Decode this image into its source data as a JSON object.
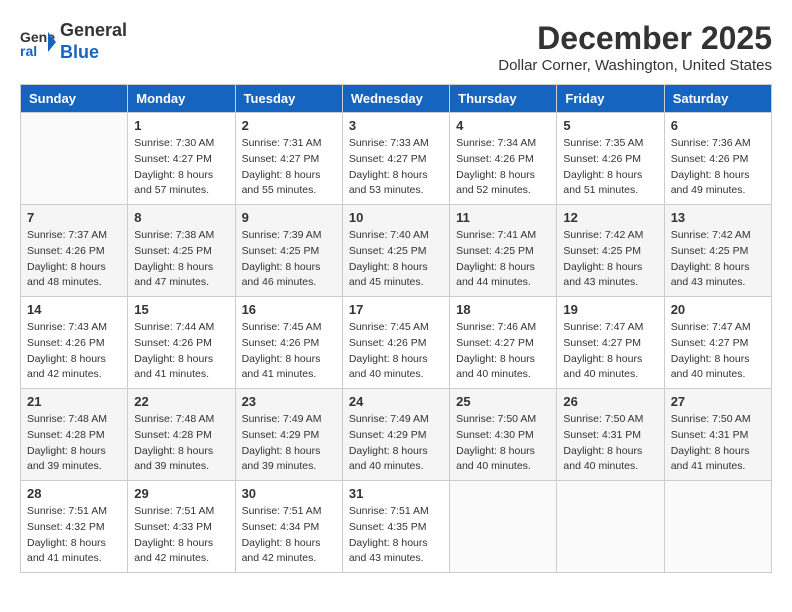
{
  "header": {
    "logo": {
      "line1": "General",
      "line2": "Blue"
    },
    "title": "December 2025",
    "subtitle": "Dollar Corner, Washington, United States"
  },
  "weekdays": [
    "Sunday",
    "Monday",
    "Tuesday",
    "Wednesday",
    "Thursday",
    "Friday",
    "Saturday"
  ],
  "weeks": [
    [
      {
        "day": "",
        "info": ""
      },
      {
        "day": "1",
        "info": "Sunrise: 7:30 AM\nSunset: 4:27 PM\nDaylight: 8 hours\nand 57 minutes."
      },
      {
        "day": "2",
        "info": "Sunrise: 7:31 AM\nSunset: 4:27 PM\nDaylight: 8 hours\nand 55 minutes."
      },
      {
        "day": "3",
        "info": "Sunrise: 7:33 AM\nSunset: 4:27 PM\nDaylight: 8 hours\nand 53 minutes."
      },
      {
        "day": "4",
        "info": "Sunrise: 7:34 AM\nSunset: 4:26 PM\nDaylight: 8 hours\nand 52 minutes."
      },
      {
        "day": "5",
        "info": "Sunrise: 7:35 AM\nSunset: 4:26 PM\nDaylight: 8 hours\nand 51 minutes."
      },
      {
        "day": "6",
        "info": "Sunrise: 7:36 AM\nSunset: 4:26 PM\nDaylight: 8 hours\nand 49 minutes."
      }
    ],
    [
      {
        "day": "7",
        "info": "Sunrise: 7:37 AM\nSunset: 4:26 PM\nDaylight: 8 hours\nand 48 minutes."
      },
      {
        "day": "8",
        "info": "Sunrise: 7:38 AM\nSunset: 4:25 PM\nDaylight: 8 hours\nand 47 minutes."
      },
      {
        "day": "9",
        "info": "Sunrise: 7:39 AM\nSunset: 4:25 PM\nDaylight: 8 hours\nand 46 minutes."
      },
      {
        "day": "10",
        "info": "Sunrise: 7:40 AM\nSunset: 4:25 PM\nDaylight: 8 hours\nand 45 minutes."
      },
      {
        "day": "11",
        "info": "Sunrise: 7:41 AM\nSunset: 4:25 PM\nDaylight: 8 hours\nand 44 minutes."
      },
      {
        "day": "12",
        "info": "Sunrise: 7:42 AM\nSunset: 4:25 PM\nDaylight: 8 hours\nand 43 minutes."
      },
      {
        "day": "13",
        "info": "Sunrise: 7:42 AM\nSunset: 4:25 PM\nDaylight: 8 hours\nand 43 minutes."
      }
    ],
    [
      {
        "day": "14",
        "info": "Sunrise: 7:43 AM\nSunset: 4:26 PM\nDaylight: 8 hours\nand 42 minutes."
      },
      {
        "day": "15",
        "info": "Sunrise: 7:44 AM\nSunset: 4:26 PM\nDaylight: 8 hours\nand 41 minutes."
      },
      {
        "day": "16",
        "info": "Sunrise: 7:45 AM\nSunset: 4:26 PM\nDaylight: 8 hours\nand 41 minutes."
      },
      {
        "day": "17",
        "info": "Sunrise: 7:45 AM\nSunset: 4:26 PM\nDaylight: 8 hours\nand 40 minutes."
      },
      {
        "day": "18",
        "info": "Sunrise: 7:46 AM\nSunset: 4:27 PM\nDaylight: 8 hours\nand 40 minutes."
      },
      {
        "day": "19",
        "info": "Sunrise: 7:47 AM\nSunset: 4:27 PM\nDaylight: 8 hours\nand 40 minutes."
      },
      {
        "day": "20",
        "info": "Sunrise: 7:47 AM\nSunset: 4:27 PM\nDaylight: 8 hours\nand 40 minutes."
      }
    ],
    [
      {
        "day": "21",
        "info": "Sunrise: 7:48 AM\nSunset: 4:28 PM\nDaylight: 8 hours\nand 39 minutes."
      },
      {
        "day": "22",
        "info": "Sunrise: 7:48 AM\nSunset: 4:28 PM\nDaylight: 8 hours\nand 39 minutes."
      },
      {
        "day": "23",
        "info": "Sunrise: 7:49 AM\nSunset: 4:29 PM\nDaylight: 8 hours\nand 39 minutes."
      },
      {
        "day": "24",
        "info": "Sunrise: 7:49 AM\nSunset: 4:29 PM\nDaylight: 8 hours\nand 40 minutes."
      },
      {
        "day": "25",
        "info": "Sunrise: 7:50 AM\nSunset: 4:30 PM\nDaylight: 8 hours\nand 40 minutes."
      },
      {
        "day": "26",
        "info": "Sunrise: 7:50 AM\nSunset: 4:31 PM\nDaylight: 8 hours\nand 40 minutes."
      },
      {
        "day": "27",
        "info": "Sunrise: 7:50 AM\nSunset: 4:31 PM\nDaylight: 8 hours\nand 41 minutes."
      }
    ],
    [
      {
        "day": "28",
        "info": "Sunrise: 7:51 AM\nSunset: 4:32 PM\nDaylight: 8 hours\nand 41 minutes."
      },
      {
        "day": "29",
        "info": "Sunrise: 7:51 AM\nSunset: 4:33 PM\nDaylight: 8 hours\nand 42 minutes."
      },
      {
        "day": "30",
        "info": "Sunrise: 7:51 AM\nSunset: 4:34 PM\nDaylight: 8 hours\nand 42 minutes."
      },
      {
        "day": "31",
        "info": "Sunrise: 7:51 AM\nSunset: 4:35 PM\nDaylight: 8 hours\nand 43 minutes."
      },
      {
        "day": "",
        "info": ""
      },
      {
        "day": "",
        "info": ""
      },
      {
        "day": "",
        "info": ""
      }
    ]
  ]
}
